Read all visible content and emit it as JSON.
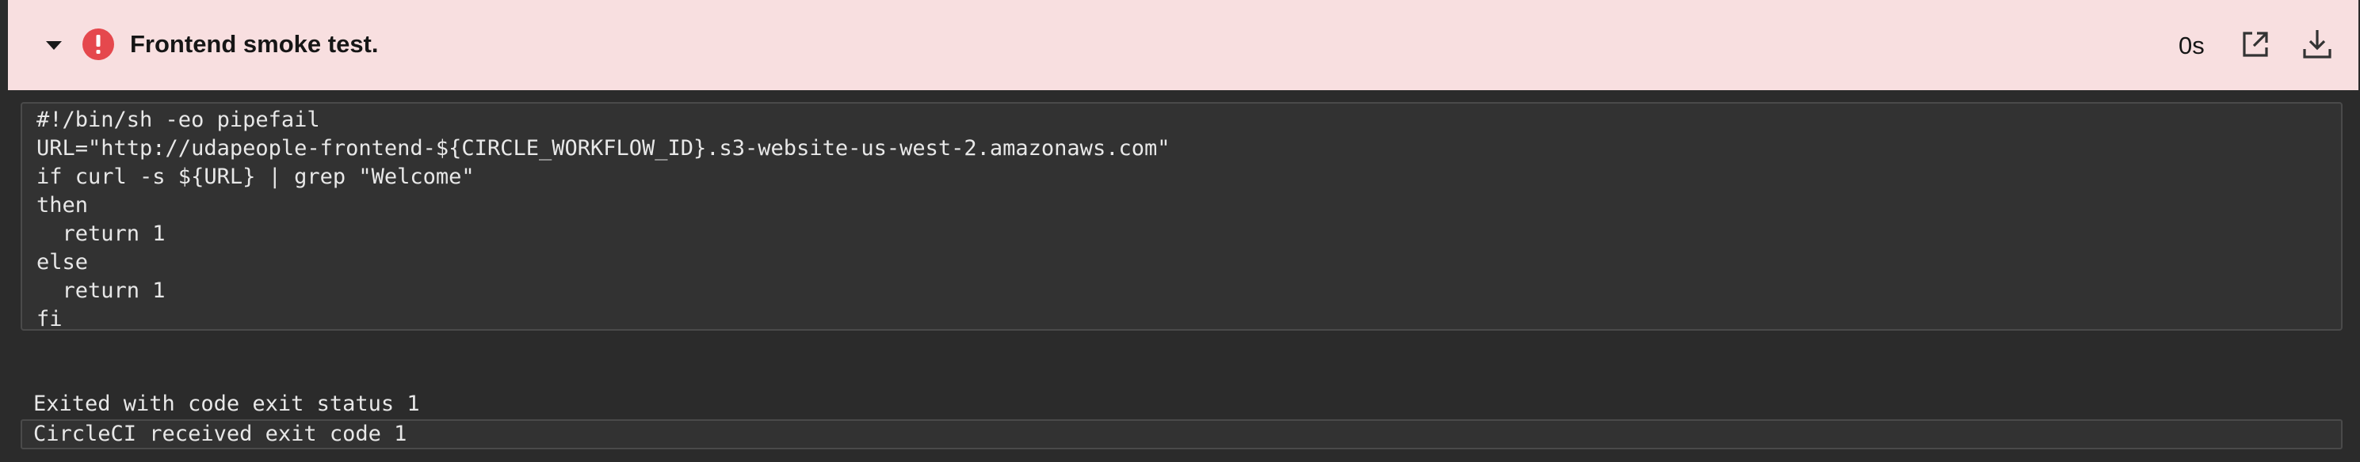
{
  "step": {
    "title": "Frontend smoke test.",
    "duration": "0s",
    "status": "failed",
    "status_color": "#e5484d",
    "header_background": "#f8dfe0"
  },
  "icons": {
    "expand": "chevron-down-icon",
    "status": "error-icon",
    "external": "external-link-icon",
    "download": "download-icon"
  },
  "command": {
    "lines": [
      "#!/bin/sh -eo pipefail",
      "URL=\"http://udapeople-frontend-${CIRCLE_WORKFLOW_ID}.s3-website-us-west-2.amazonaws.com\"",
      "if curl -s ${URL} | grep \"Welcome\"",
      "then",
      "  return 1",
      "else",
      "  return 1",
      "fi"
    ]
  },
  "output": {
    "exit_message": "Exited with code exit status 1",
    "received_message": "CircleCI received exit code 1"
  }
}
